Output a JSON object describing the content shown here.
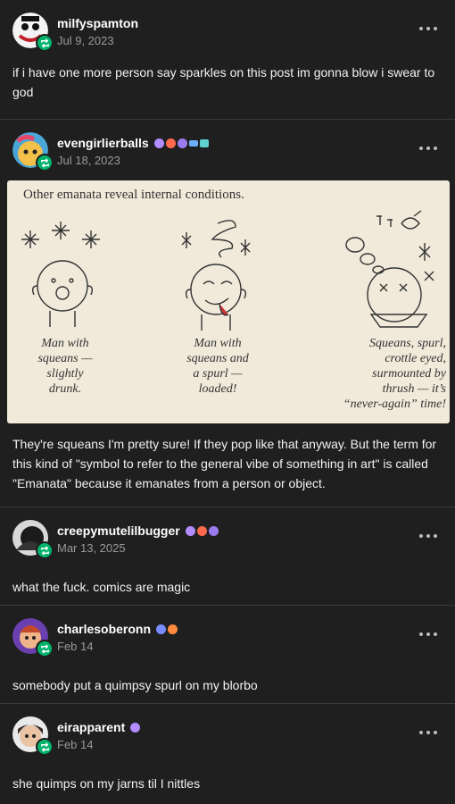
{
  "posts": [
    {
      "username": "milfyspamton",
      "date": "Jul 9, 2023",
      "body": "if i have one more person say sparkles on this post im gonna blow i swear to god"
    },
    {
      "username": "evengirlierballs",
      "date": "Jul 18, 2023",
      "image": {
        "caption": "Other emanata reveal internal conditions.",
        "labels": [
          "Man with\nsqueans —\nslightly\ndrunk.",
          "Man with\nsqueans and\na spurl —\nloaded!",
          "Squeans, spurl,\ncrottle eyed,\nsurmounted by\nthrush — it’s\n“never-again” time!"
        ]
      },
      "body": "They're squeans I'm pretty sure! If they pop like that anyway. But the term for this kind of \"symbol to refer to the general vibe of something in art\" is called \"Emanata\" because it emanates from a person or object."
    },
    {
      "username": "creepymutelilbugger",
      "date": "Mar 13, 2025",
      "body": "what the fuck. comics are magic"
    },
    {
      "username": "charlesoberonn",
      "date": "Feb 14",
      "body": "somebody put a quimpsy spurl on my blorbo"
    },
    {
      "username": "eirapparent",
      "date": "Feb 14",
      "body": "she quimps on my jarns til I nittles"
    }
  ],
  "colors": {
    "background": "#1f1f1f",
    "reblog_badge": "#00b36b",
    "muted_text": "#9a9a9a"
  },
  "icons": {
    "reblog": "reblog-icon",
    "more": "more-options-icon"
  }
}
